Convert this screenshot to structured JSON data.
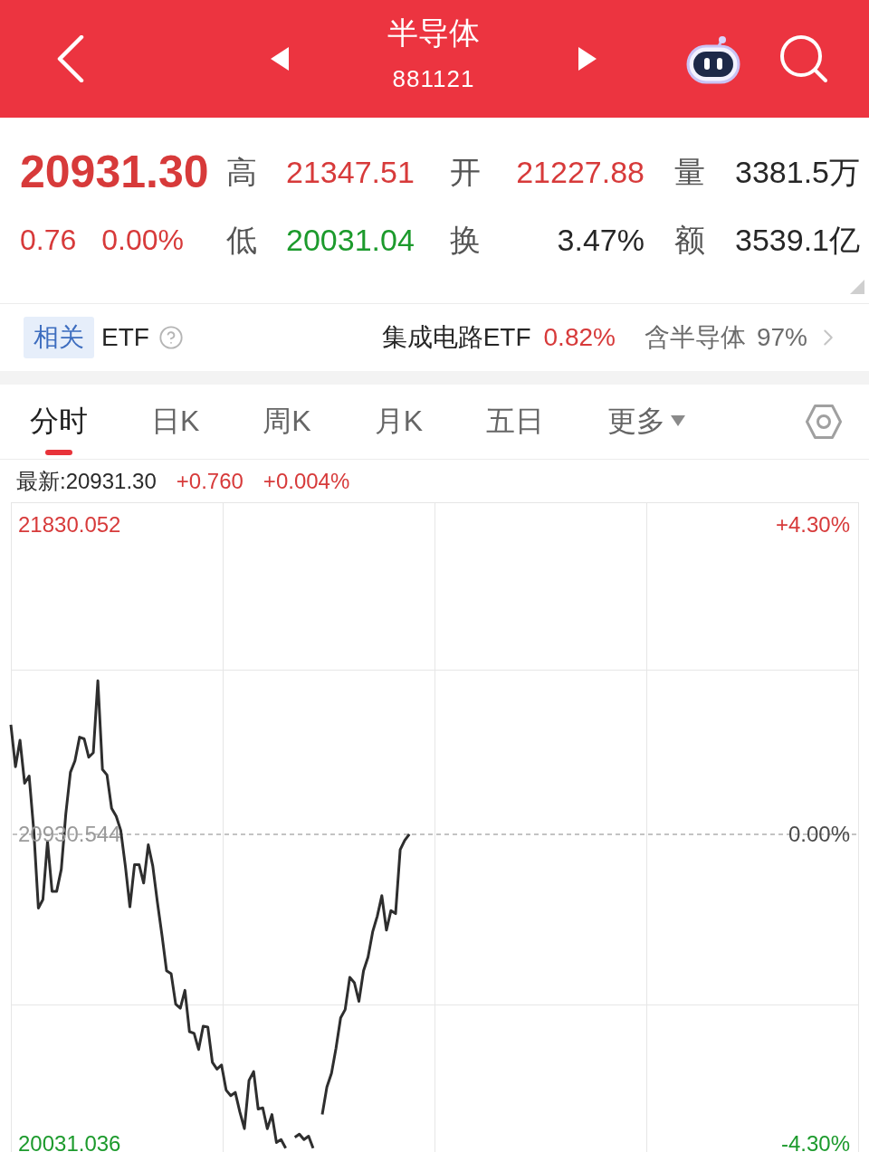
{
  "header": {
    "title": "半导体",
    "code": "881121"
  },
  "quote": {
    "price": {
      "text": "20931.30",
      "color": "#d73a3a"
    },
    "changes": [
      {
        "text": "0.76",
        "color": "#d73a3a"
      },
      {
        "text": "0.00%",
        "color": "#d73a3a"
      }
    ],
    "stats": [
      {
        "label": "高",
        "value": "21347.51",
        "color": "#d73a3a"
      },
      {
        "label": "开",
        "value": "21227.88",
        "color": "#d73a3a"
      },
      {
        "label": "量",
        "value": "3381.5万",
        "color": "#262626"
      },
      {
        "label": "低",
        "value": "20031.04",
        "color": "#1c9a2c"
      },
      {
        "label": "换",
        "value": "3.47%",
        "color": "#262626"
      },
      {
        "label": "额",
        "value": "3539.1亿",
        "color": "#262626"
      }
    ]
  },
  "etf": {
    "badge": "相关",
    "label": "ETF",
    "fund": {
      "name": "集成电路ETF",
      "change": "0.82%",
      "color": "#d73a3a"
    },
    "holding": {
      "label": "含半导体",
      "percent": "97%"
    }
  },
  "tabs": [
    {
      "label": "分时",
      "selected": true,
      "kind": "tab"
    },
    {
      "label": "日K",
      "selected": false,
      "kind": "tab"
    },
    {
      "label": "周K",
      "selected": false,
      "kind": "tab"
    },
    {
      "label": "月K",
      "selected": false,
      "kind": "tab"
    },
    {
      "label": "五日",
      "selected": false,
      "kind": "tab"
    },
    {
      "label": "更多",
      "selected": false,
      "kind": "menu"
    }
  ],
  "chart": {
    "latest": "最新:20931.30",
    "changes": [
      {
        "text": "+0.760",
        "color": "#d73a3a"
      },
      {
        "text": "+0.004%",
        "color": "#d73a3a"
      }
    ],
    "axis_right": [
      {
        "text": "+4.30%",
        "color": "#d73a3a"
      },
      {
        "text": "0.00%",
        "color": "#4a4a4a"
      },
      {
        "text": "-4.30%",
        "color": "#1c9a2c"
      }
    ],
    "chart_data": {
      "type": "line",
      "ylim": [
        20007,
        21896
      ],
      "yticks": [
        {
          "value": 21830.052,
          "label": "21830.052"
        },
        {
          "value": 20930.544,
          "label": "20930.544"
        },
        {
          "value": 20031.036,
          "label": "20031.036"
        }
      ],
      "ref_lines": [
        {
          "axis": "y",
          "value": 20930.544
        }
      ],
      "categories": [
        null,
        null,
        null,
        null,
        null,
        null,
        null,
        null,
        null,
        null,
        null,
        null,
        null,
        null,
        null,
        null,
        null,
        null,
        null,
        null,
        null,
        null,
        null,
        null,
        null,
        null,
        null,
        null,
        null,
        null,
        null,
        null,
        null,
        null,
        null,
        null,
        null,
        null,
        null,
        null,
        null,
        null,
        null,
        null,
        null,
        null,
        null,
        null,
        null,
        null,
        null,
        null,
        null,
        null,
        null,
        null,
        null,
        null,
        null,
        null,
        null,
        null,
        null,
        null,
        null,
        null,
        null,
        null,
        null,
        null,
        null,
        null,
        null,
        null,
        null,
        null,
        null,
        null,
        null,
        null,
        null,
        null,
        null,
        null,
        null,
        null,
        null,
        null,
        null,
        null,
        null,
        null,
        null,
        null,
        null,
        null,
        null,
        null,
        null,
        null,
        null,
        null,
        null,
        null,
        null,
        null,
        null,
        null,
        null,
        null,
        null,
        null,
        null,
        null,
        null,
        null,
        null,
        null,
        null,
        null,
        null,
        null,
        null,
        null,
        null,
        null,
        null,
        null,
        null,
        null,
        null,
        null,
        null,
        null,
        null,
        null,
        null,
        null,
        null,
        null,
        null,
        null,
        null,
        null,
        null,
        null,
        null,
        null,
        null,
        null,
        null,
        null,
        null,
        null,
        null,
        null,
        null,
        null,
        null,
        null,
        null,
        null,
        null,
        null,
        null,
        null,
        null,
        null,
        null,
        null,
        null,
        null,
        null,
        null,
        null,
        null,
        null,
        null,
        null,
        null,
        null,
        null,
        null,
        null,
        null,
        null
      ],
      "series": [
        {
          "color": "#2e2e2e",
          "values": [
            21249,
            21127,
            21204,
            21079,
            21100,
            20942,
            20716,
            20741,
            20910,
            20765,
            20765,
            20829,
            20990,
            21111,
            21144,
            21213,
            21208,
            21155,
            21168,
            21377,
            21119,
            21103,
            21006,
            20983,
            20942,
            20838,
            20720,
            20842,
            20842,
            20789,
            20900,
            20838,
            20733,
            20636,
            20534,
            20525,
            20437,
            20425,
            20477,
            20357,
            20352,
            20305,
            20373,
            20370,
            20268,
            20248,
            20260,
            20187,
            20171,
            20180,
            20123,
            20075,
            20215,
            20241,
            20132,
            20135,
            20075,
            20116,
            20035,
            20043,
            20018,
            null,
            20050,
            20059,
            20043,
            20053,
            20018,
            null,
            20116,
            20196,
            20236,
            20309,
            20397,
            20421,
            20515,
            20499,
            20445,
            20534,
            20574,
            20647,
            20693,
            20752,
            20652,
            20709,
            20700,
            20886,
            20913,
            20931,
            null,
            null,
            null,
            null,
            null,
            null,
            null,
            null,
            null,
            null,
            null,
            null,
            null,
            null,
            null,
            null,
            null,
            null,
            null,
            null,
            null,
            null,
            null,
            null,
            null,
            null,
            null,
            null,
            null,
            null,
            null,
            null,
            null,
            null,
            null,
            null,
            null,
            null,
            null,
            null,
            null,
            null,
            null,
            null,
            null,
            null,
            null,
            null,
            null,
            null,
            null,
            null,
            null,
            null,
            null,
            null,
            null,
            null,
            null,
            null,
            null,
            null,
            null,
            null,
            null,
            null,
            null,
            null,
            null,
            null,
            null,
            null,
            null,
            null,
            null,
            null,
            null,
            null,
            null,
            null,
            null,
            null,
            null,
            null,
            null,
            null,
            null,
            null,
            null,
            null,
            null,
            null,
            null,
            null,
            null,
            null,
            null,
            null
          ]
        }
      ]
    }
  }
}
